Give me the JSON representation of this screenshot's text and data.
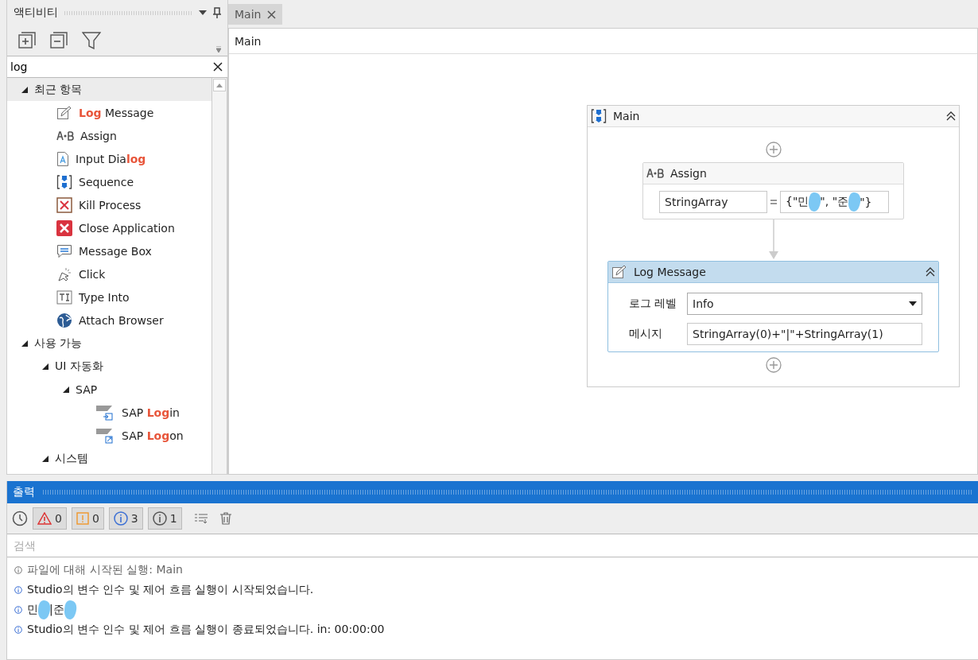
{
  "activities_panel": {
    "title": "액티비티",
    "search": {
      "value": "log"
    },
    "tree": [
      {
        "label": "최근 항목",
        "expanded": true,
        "selected": true,
        "children": [
          {
            "label": "**Log** Message",
            "kind": "log",
            "selected": false
          },
          {
            "label": "Assign",
            "kind": "assign",
            "selected": false
          },
          {
            "label": "Input Dia**log**",
            "kind": "input",
            "selected": false
          },
          {
            "label": "Sequence",
            "kind": "sequence",
            "selected": false
          },
          {
            "label": "Kill Process",
            "kind": "kill",
            "selected": false
          },
          {
            "label": "Close Application",
            "kind": "close",
            "selected": false
          },
          {
            "label": "Message Box",
            "kind": "message",
            "selected": false
          },
          {
            "label": "Click",
            "kind": "click",
            "selected": false
          },
          {
            "label": "Type Into",
            "kind": "type",
            "selected": false
          },
          {
            "label": "Attach Browser",
            "kind": "browser",
            "selected": false
          }
        ]
      },
      {
        "label": "사용 가능",
        "expanded": true,
        "selected": false,
        "children": [
          {
            "label": "UI 자동화",
            "expanded": true,
            "selected": false,
            "children": [
              {
                "label": "SAP",
                "expanded": true,
                "selected": false,
                "children": [
                  {
                    "label": "SAP **Log**in",
                    "kind": "login",
                    "selected": false
                  },
                  {
                    "label": "SAP **Log**on",
                    "kind": "logon",
                    "selected": false
                  }
                ]
              }
            ]
          },
          {
            "label": "시스템",
            "expanded": true,
            "selected": false
          }
        ]
      }
    ]
  },
  "designer": {
    "tabs": [
      {
        "label": "Main",
        "selected": true
      }
    ],
    "breadcrumb": "Main",
    "sequence": {
      "title": "Main",
      "activities": [
        {
          "kind": "assign",
          "title": "Assign",
          "selected": false,
          "to": "StringArray",
          "value": [
            {
              "kind": "text",
              "text": "{\"민"
            },
            {
              "kind": "redaction"
            },
            {
              "kind": "text",
              "text": "\", \"준"
            },
            {
              "kind": "redaction"
            },
            {
              "kind": "text",
              "text": "\"}"
            }
          ]
        },
        {
          "kind": "log",
          "title": "Log Message",
          "selected": true,
          "level_label": "로그 레벨",
          "level": "Info",
          "message_label": "메시지",
          "message": "StringArray(0)+\"|\"+StringArray(1)"
        }
      ]
    }
  },
  "output": {
    "title": "출력",
    "filters": [
      {
        "kind": "error",
        "count": "0",
        "on": true
      },
      {
        "kind": "warning",
        "count": "0",
        "on": true
      },
      {
        "kind": "info",
        "count": "3",
        "on": true
      },
      {
        "kind": "trace",
        "count": "1",
        "on": true
      }
    ],
    "search": {
      "placeholder": "검색"
    },
    "lines": [
      {
        "kind": "trace",
        "segments": [
          {
            "kind": "text",
            "text": "파일에 대해 시작된 실행: Main"
          }
        ]
      },
      {
        "kind": "info",
        "segments": [
          {
            "kind": "text",
            "text": "Studio의 변수 인수 및 제어 흐름 실행이 시작되었습니다."
          }
        ]
      },
      {
        "kind": "info",
        "segments": [
          {
            "kind": "text",
            "text": "민"
          },
          {
            "kind": "redaction"
          },
          {
            "kind": "text",
            "text": "|준"
          },
          {
            "kind": "redaction"
          }
        ]
      },
      {
        "kind": "info",
        "segments": [
          {
            "kind": "text",
            "text": "Studio의 변수 인수 및 제어 흐름 실행이 종료되었습니다. in: 00:00:00"
          }
        ]
      }
    ]
  }
}
